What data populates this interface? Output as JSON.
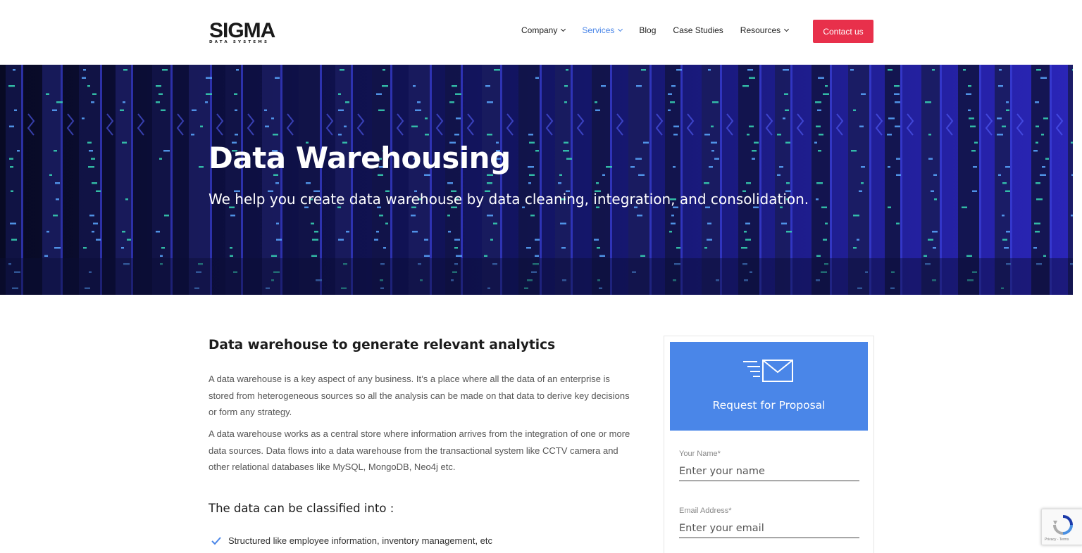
{
  "header": {
    "logo": {
      "main": "SIGMA",
      "sub": "DATA SYSTEMS"
    },
    "nav": [
      {
        "label": "Company",
        "has_dropdown": true,
        "active": false
      },
      {
        "label": "Services",
        "has_dropdown": true,
        "active": true
      },
      {
        "label": "Blog",
        "has_dropdown": false,
        "active": false
      },
      {
        "label": "Case Studies",
        "has_dropdown": false,
        "active": false
      },
      {
        "label": "Resources",
        "has_dropdown": true,
        "active": false
      }
    ],
    "contact_label": "Contact us"
  },
  "hero": {
    "title": "Data Warehousing",
    "subtitle": "We help you create data warehouse by data cleaning, integration, and consolidation."
  },
  "main": {
    "heading": "Data warehouse to generate relevant analytics",
    "paragraphs": [
      "A data warehouse is a key aspect of any business. It’s a place where all the data of an enterprise is stored from heterogeneous sources so all the analysis can be made on that data to derive key decisions or form any strategy.",
      "A data warehouse works as a central store where information arrives from the integration of one or more data sources. Data flows into a data warehouse from the transactional system like CCTV camera and other relational databases like MySQL, MongoDB, Neo4j etc."
    ],
    "subheading": "The data can be classified into :",
    "list": [
      "Structured like employee information, inventory management, etc"
    ]
  },
  "form": {
    "banner_title": "Request for Proposal",
    "fields": [
      {
        "label": "Your Name*",
        "placeholder": "Enter your name"
      },
      {
        "label": "Email Address*",
        "placeholder": "Enter your email"
      }
    ]
  },
  "recaptcha": {
    "text": "Privacy - Terms"
  },
  "colors": {
    "accent": "#4a86e8",
    "contact": "#e8304b",
    "hero_bg": "#0a0c2a"
  },
  "icons": [
    "chevron-down-icon",
    "mail-icon",
    "check-icon",
    "recaptcha-icon"
  ]
}
